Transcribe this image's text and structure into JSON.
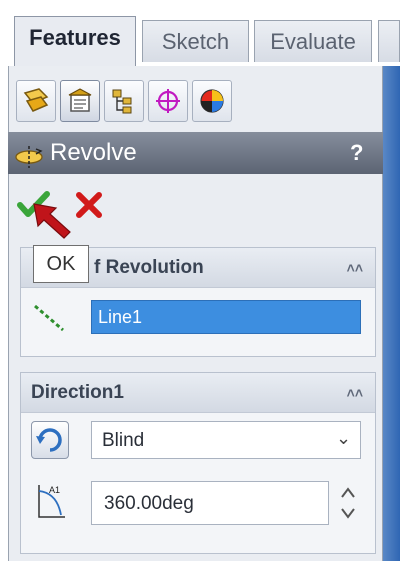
{
  "tabs": [
    {
      "label": "Features",
      "active": true
    },
    {
      "label": "Sketch",
      "active": false
    },
    {
      "label": "Evaluate",
      "active": false
    }
  ],
  "toolbar_icons": [
    "feature-manager-icon",
    "property-manager-icon",
    "configuration-manager-icon",
    "dimxpert-icon",
    "display-manager-icon"
  ],
  "feature": {
    "title": "Revolve",
    "help": "?",
    "ok_tooltip": "OK"
  },
  "axis_section": {
    "title": "Axis of Revolution",
    "visible_title": "f Revolution",
    "value": "Line1"
  },
  "direction_section": {
    "title": "Direction1",
    "type": "Blind",
    "angle": "360.00deg"
  },
  "colors": {
    "titlebar": "#6b7380",
    "selection": "#3d8ee0",
    "ok_green": "#3aa53a",
    "cancel_red": "#d11a1a",
    "arrow_red": "#c0141a"
  }
}
